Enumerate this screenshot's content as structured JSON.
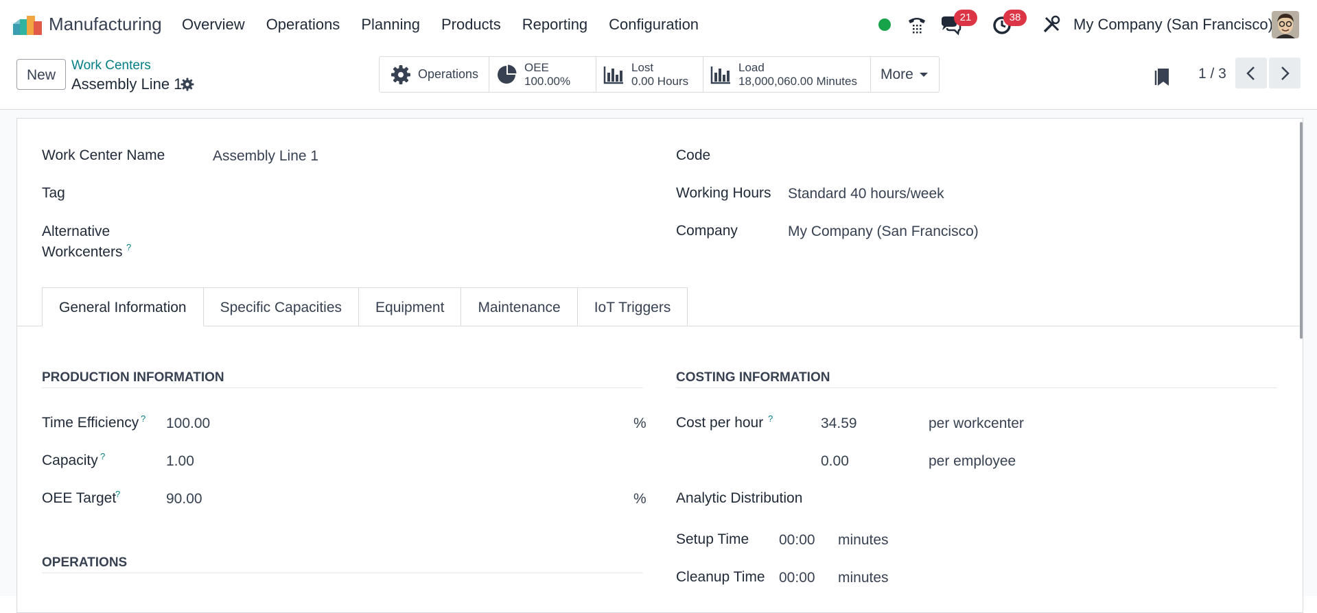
{
  "app": {
    "name": "Manufacturing",
    "menu": [
      "Overview",
      "Operations",
      "Planning",
      "Products",
      "Reporting",
      "Configuration"
    ]
  },
  "systray": {
    "messages_count": "21",
    "activities_count": "38",
    "company": "My Company (San Francisco)",
    "status_color": "#16a34a",
    "badge_color": "#dc3545"
  },
  "control_panel": {
    "new_label": "New",
    "breadcrumb": "Work Centers",
    "record_title": "Assembly Line 1",
    "smart_buttons": {
      "operations": {
        "label": "Operations",
        "icon": "gear-icon"
      },
      "oee": {
        "label": "OEE",
        "value": "100.00%",
        "icon": "pie-chart-icon"
      },
      "lost": {
        "label": "Lost",
        "value": "0.00 Hours",
        "icon": "bar-chart-icon"
      },
      "load": {
        "label": "Load",
        "value": "18,000,060.00 Minutes",
        "icon": "bar-chart-icon"
      },
      "more": {
        "label": "More"
      }
    },
    "pager": "1 / 3"
  },
  "form": {
    "work_center_name": {
      "label": "Work Center Name",
      "value": "Assembly Line 1"
    },
    "tag": {
      "label": "Tag"
    },
    "alternative": {
      "label_line1": "Alternative",
      "label_line2": "Workcenters"
    },
    "code": {
      "label": "Code"
    },
    "working_hours": {
      "label": "Working Hours",
      "value": "Standard 40 hours/week"
    },
    "company": {
      "label": "Company",
      "value": "My Company (San Francisco)"
    },
    "help_mark": "?"
  },
  "tabs": [
    "General Information",
    "Specific Capacities",
    "Equipment",
    "Maintenance",
    "IoT Triggers"
  ],
  "general": {
    "production": {
      "title": "PRODUCTION INFORMATION",
      "time_efficiency": {
        "label": "Time Efficiency",
        "value": "100.00",
        "unit": "%"
      },
      "capacity": {
        "label": "Capacity",
        "value": "1.00"
      },
      "oee_target": {
        "label": "OEE Target",
        "value": "90.00",
        "unit": "%"
      }
    },
    "costing": {
      "title": "COSTING INFORMATION",
      "cost_per_hour": {
        "label": "Cost per hour",
        "value": "34.59",
        "unit": "per workcenter"
      },
      "cost_per_employee": {
        "value": "0.00",
        "unit": "per employee"
      },
      "analytic": {
        "label": "Analytic Distribution"
      },
      "setup_time": {
        "label": "Setup Time",
        "value": "00:00",
        "unit": "minutes"
      },
      "cleanup_time": {
        "label": "Cleanup Time",
        "value": "00:00",
        "unit": "minutes"
      }
    },
    "operations_title": "OPERATIONS"
  }
}
